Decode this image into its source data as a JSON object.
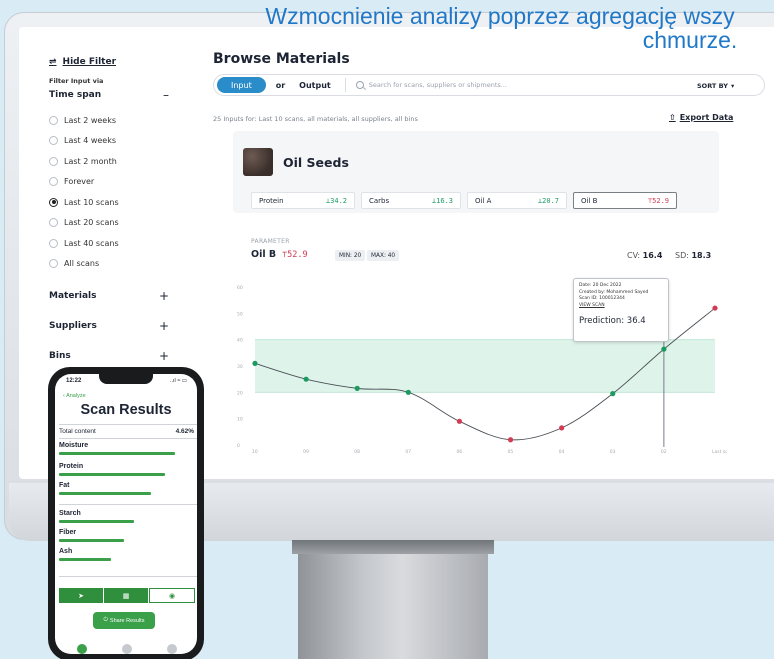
{
  "headline": {
    "line1": "Wzmocnienie analizy poprzez agregację wszy",
    "line2": "chmurze."
  },
  "sidebar": {
    "hide_filter": "Hide Filter",
    "filter_label": "Filter Input via",
    "time_span": "Time span",
    "time_options": [
      {
        "label": "Last 2 weeks",
        "selected": false
      },
      {
        "label": "Last 4 weeks",
        "selected": false
      },
      {
        "label": "Last 2 month",
        "selected": false
      },
      {
        "label": "Forever",
        "selected": false
      },
      {
        "label": "Last 10 scans",
        "selected": true
      },
      {
        "label": "Last 20 scans",
        "selected": false
      },
      {
        "label": "Last 40 scans",
        "selected": false
      },
      {
        "label": "All scans",
        "selected": false
      }
    ],
    "groups": [
      "Materials",
      "Suppliers",
      "Bins"
    ]
  },
  "main": {
    "title": "Browse Materials",
    "input_tab": "Input",
    "or": "or",
    "output_tab": "Output",
    "search_placeholder": "Search for scans, suppliers or shipments...",
    "sort_by": "SORT BY",
    "count_text": "25 Inputs for: Last 10 scans, all materials, all suppliers, all bins",
    "export": "Export Data",
    "material": "Oil Seeds",
    "params": [
      {
        "name": "Protein",
        "value": "⊥34.2",
        "status": "ok"
      },
      {
        "name": "Carbs",
        "value": "⊥16.3",
        "status": "ok"
      },
      {
        "name": "Oil A",
        "value": "⊥20.7",
        "status": "ok"
      },
      {
        "name": "Oil B",
        "value": "⊤52.9",
        "status": "high"
      }
    ],
    "parameter_label": "PARAMETER",
    "selected_param": "Oil B",
    "selected_value": "⊤52.9",
    "min": "MIN: 20",
    "max": "MAX: 40",
    "cv_label": "CV:",
    "cv_value": "16.4",
    "sd_label": "SD:",
    "sd_value": "18.3"
  },
  "chart_data": {
    "type": "line",
    "y_ticks": [
      0,
      10,
      20,
      30,
      40,
      50,
      60
    ],
    "ylim": [
      0,
      60
    ],
    "x_labels": [
      "10",
      "09",
      "08",
      "07",
      "06",
      "05",
      "04",
      "03",
      "02",
      "Last scan"
    ],
    "band": [
      20,
      40
    ],
    "points": [
      {
        "x": 0,
        "y": 31,
        "status": "ok"
      },
      {
        "x": 1,
        "y": 25,
        "status": "ok"
      },
      {
        "x": 2,
        "y": 21.5,
        "status": "ok"
      },
      {
        "x": 3,
        "y": 20,
        "status": "ok"
      },
      {
        "x": 4,
        "y": 9,
        "status": "bad"
      },
      {
        "x": 5,
        "y": 2,
        "status": "bad"
      },
      {
        "x": 6,
        "y": 6.5,
        "status": "bad"
      },
      {
        "x": 7,
        "y": 19.5,
        "status": "ok"
      },
      {
        "x": 8,
        "y": 36.4,
        "status": "ok"
      },
      {
        "x": 9,
        "y": 52,
        "status": "bad"
      }
    ],
    "highlight_index": 8,
    "colors": {
      "ok": "#1d9a62",
      "bad": "#d33b52",
      "band": "#def4ea"
    }
  },
  "tooltip": {
    "date": "Date: 20 Dec 2022",
    "created": "Created by: Mohammed Sayed",
    "scan_id": "Scan ID: 100012344",
    "view": "VIEW SCAN",
    "prediction": "Prediction:  36.4"
  },
  "phone": {
    "time": "12:22",
    "signal": "..ıl ≈ ▭",
    "back": "Analyze",
    "title": "Scan Results",
    "total_label": "Total content",
    "total_value": "4.62%",
    "nutrients": [
      {
        "label": "Moisture",
        "fill": 0.85
      },
      {
        "label": "Protein",
        "fill": 0.78
      },
      {
        "label": "Fat",
        "fill": 0.68
      },
      {
        "label": "Starch",
        "fill": 0.55
      },
      {
        "label": "Fiber",
        "fill": 0.48
      },
      {
        "label": "Ash",
        "fill": 0.38
      }
    ],
    "share": "Share Results"
  }
}
